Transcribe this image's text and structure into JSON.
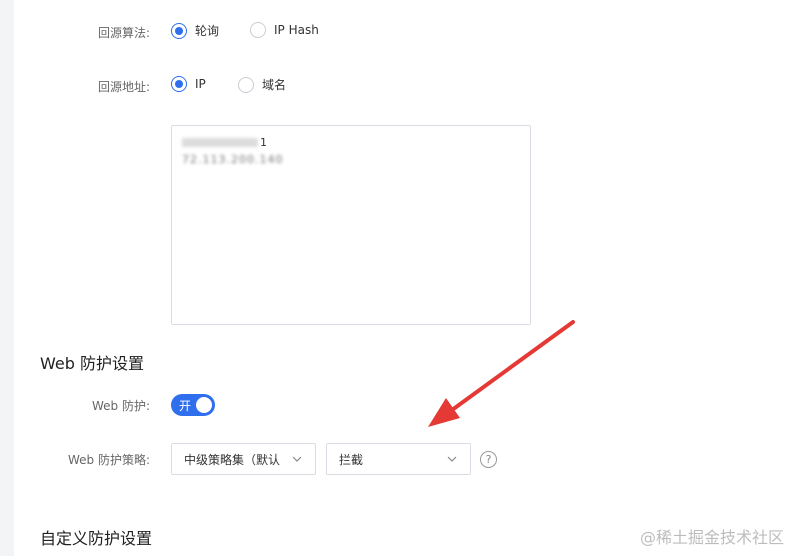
{
  "origin_algorithm": {
    "label": "回源算法:",
    "options": [
      {
        "label": "轮询",
        "checked": true
      },
      {
        "label": "IP Hash",
        "checked": false
      }
    ]
  },
  "origin_address": {
    "label": "回源地址:",
    "options": [
      {
        "label": "IP",
        "checked": true
      },
      {
        "label": "域名",
        "checked": false
      }
    ],
    "lines": [
      "1",
      "72.113.200.140"
    ]
  },
  "web_protection": {
    "section_title": "Web 防护设置",
    "toggle_label": "Web 防护:",
    "toggle_text": "开",
    "policy_label": "Web 防护策略:",
    "policy_select": "中级策略集（默认",
    "action_select": "拦截",
    "help": "?"
  },
  "custom_protection": {
    "section_title": "自定义防护设置"
  },
  "watermark": "@稀土掘金技术社区",
  "colors": {
    "accent": "#2f6fed",
    "annotation_arrow": "#e53935"
  }
}
